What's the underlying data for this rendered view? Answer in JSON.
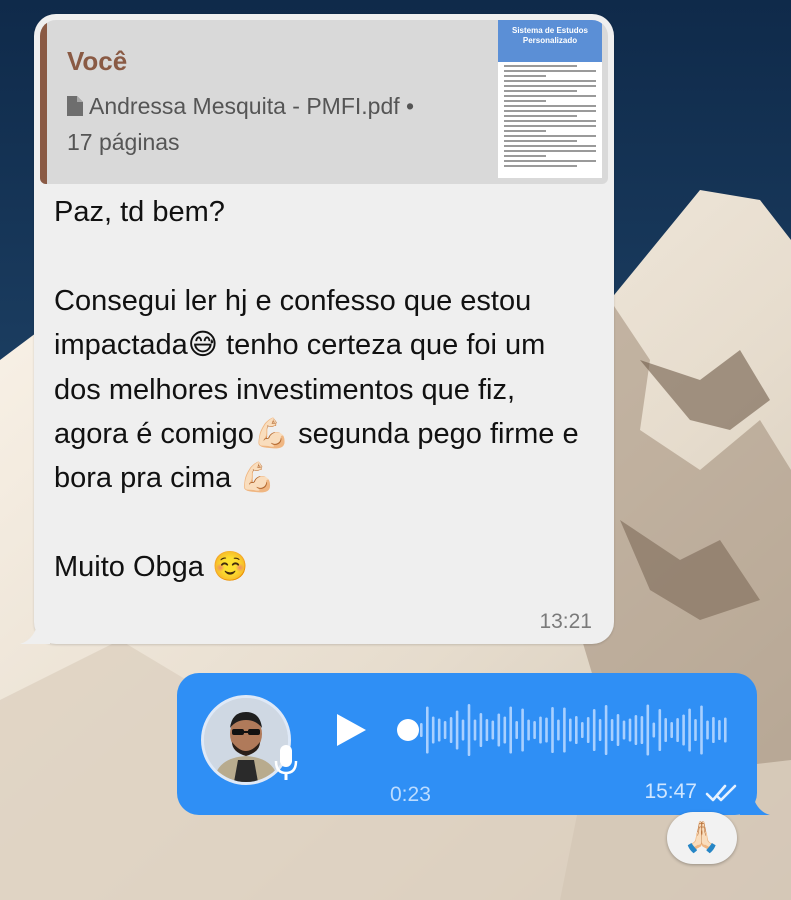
{
  "incoming": {
    "reply": {
      "sender": "Você",
      "file_name": "Andressa Mesquita - PMFI.pdf •",
      "page_count": "17 páginas",
      "thumbnail_title": "Sistema de Estudos Personalizado"
    },
    "text": "Paz, td bem?\n\nConsegui ler hj e confesso que estou impactada😅 tenho certeza que foi um dos melhores investimentos que fiz, agora é comigo💪🏻 segunda pego firme e bora pra cima 💪🏻\n\nMuito Obga ☺️",
    "time": "13:21"
  },
  "outgoing": {
    "duration": "0:23",
    "time": "15:47",
    "status": "read"
  },
  "reaction": {
    "emoji": "🙏🏻"
  },
  "colors": {
    "incoming_bubble": "#efefef",
    "reply_accent": "#8a5a44",
    "outgoing_bubble": "#2f8ff5"
  }
}
